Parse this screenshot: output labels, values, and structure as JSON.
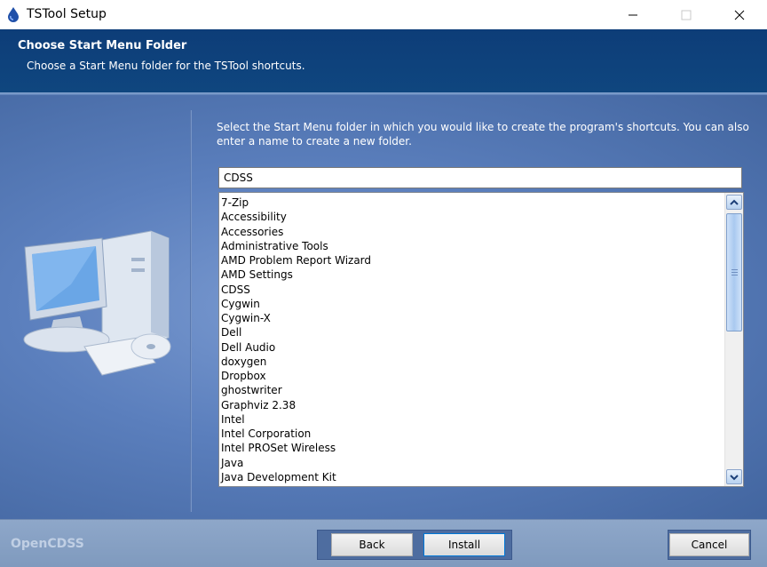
{
  "window": {
    "title": "TSTool Setup",
    "icons": {
      "app": "tstool-drop-icon",
      "minimize": "minimize-icon",
      "maximize": "maximize-icon",
      "close": "close-icon"
    }
  },
  "header": {
    "title": "Choose Start Menu Folder",
    "subtitle": "Choose a Start Menu folder for the TSTool shortcuts."
  },
  "body": {
    "description": "Select the Start Menu folder in which you would like to create the program's shortcuts. You can also enter a name to create a new folder.",
    "folder_value": "CDSS",
    "folders": [
      "7-Zip",
      "Accessibility",
      "Accessories",
      "Administrative Tools",
      "AMD Problem Report Wizard",
      "AMD Settings",
      "CDSS",
      "Cygwin",
      "Cygwin-X",
      "Dell",
      "Dell Audio",
      "doxygen",
      "Dropbox",
      "ghostwriter",
      "Graphviz 2.38",
      "Intel",
      "Intel Corporation",
      "Intel PROSet Wireless",
      "Java",
      "Java Development Kit"
    ]
  },
  "footer": {
    "brand": "OpenCDSS",
    "back_label": "Back",
    "install_label": "Install",
    "cancel_label": "Cancel"
  },
  "colors": {
    "header_bg": "#0f467f",
    "main_bg": "#5b7fbd",
    "footer_bg": "#8ea7c9",
    "accent": "#0078d7"
  }
}
